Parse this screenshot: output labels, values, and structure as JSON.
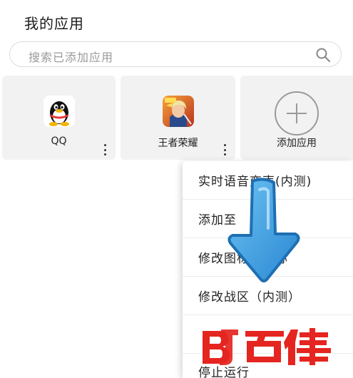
{
  "header": {
    "title": "我的应用"
  },
  "search": {
    "placeholder": "搜索已添加应用",
    "icon": "search-icon"
  },
  "apps": [
    {
      "name": "QQ",
      "icon": "qq-penguin-icon"
    },
    {
      "name": "王者荣耀",
      "icon": "honor-of-kings-icon"
    }
  ],
  "add_app": {
    "label": "添加应用",
    "icon": "plus-circle-icon"
  },
  "context_menu": {
    "items": [
      {
        "label": "实时语音变声(内测)"
      },
      {
        "label": "添加至"
      },
      {
        "label": "修改图标及名称"
      },
      {
        "label": "修改战区（内测）"
      },
      {
        "label": ""
      },
      {
        "label": "停止运行"
      }
    ]
  },
  "watermark": {
    "text": "百佳"
  },
  "colors": {
    "arrow": "#3a9fe0",
    "watermark_red": "#e5251f",
    "card_bg": "#f2f2f2"
  }
}
